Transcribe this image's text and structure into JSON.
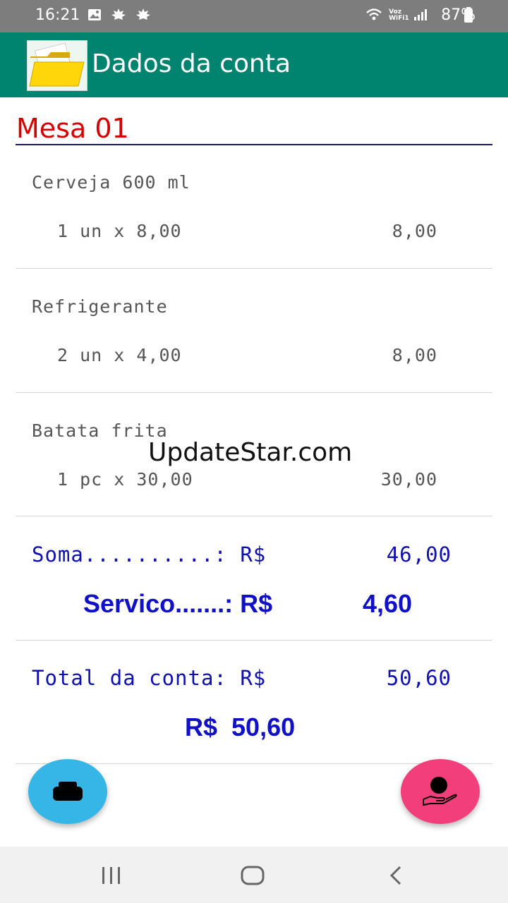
{
  "status_bar": {
    "time": "16:21",
    "battery": "87%",
    "voz_line1": "Voz",
    "voz_line2": "WiFi1"
  },
  "app_bar": {
    "title": "Dados da conta",
    "icon": "folder-icon",
    "color": "#00836f"
  },
  "table": {
    "title": "Mesa 01"
  },
  "items": [
    {
      "name": "Cerveja 600 ml",
      "qty": "1 un x 8,00",
      "total": "8,00"
    },
    {
      "name": "Refrigerante",
      "qty": "2 un x 4,00",
      "total": "8,00"
    },
    {
      "name": "Batata frita",
      "qty": "1 pc x 30,00",
      "total": "30,00"
    }
  ],
  "summary": {
    "soma_label": "Soma..........: R$",
    "soma_value": "46,00",
    "servico_label": "Servico.......: R$",
    "servico_value": "4,60",
    "total_label": "Total da conta: R$",
    "total_value": "50,60",
    "grand_total": "R$  50,60"
  },
  "watermark": "UpdateStar.com",
  "fabs": {
    "print_icon": "printer-icon",
    "print_color": "#36b6e6",
    "pay_icon": "hand-coin-icon",
    "pay_color": "#f23f7b"
  },
  "nav": {
    "recents_icon": "recents-icon",
    "home_icon": "home-icon",
    "back_icon": "back-icon"
  }
}
